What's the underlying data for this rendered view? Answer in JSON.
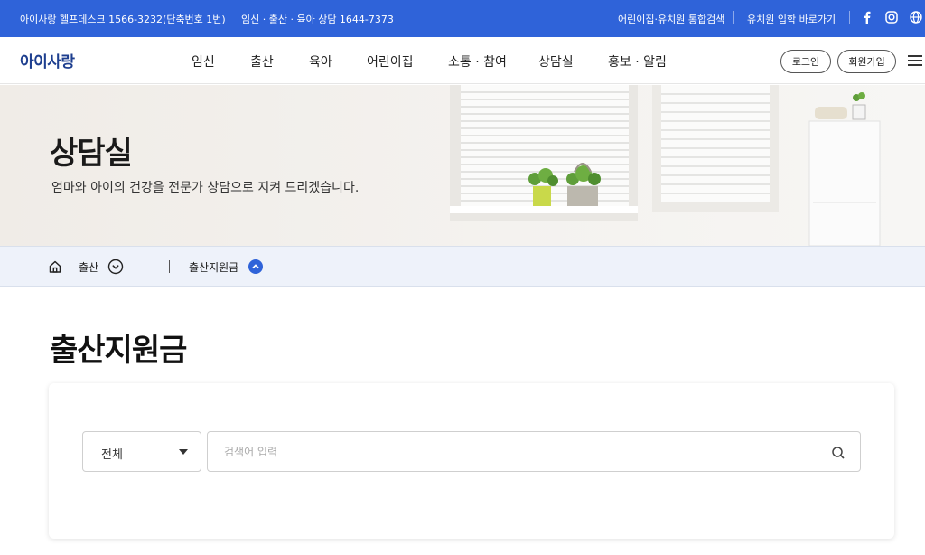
{
  "topbar": {
    "helpdesk": "아이사랑 헬프데스크 1566-3232(단축번호 1번)",
    "counsel": "임신 · 출산 · 육아 상담 1644-7373",
    "integrated_search": "어린이집·유치원 통합검색",
    "kindergarten_link": "유치원 입학 바로가기",
    "icons": [
      "facebook-icon",
      "instagram-icon",
      "globe-icon"
    ]
  },
  "nav": {
    "logo": "아이사랑",
    "menu": [
      "임신",
      "출산",
      "육아",
      "어린이집",
      "소통 · 참여",
      "상담실",
      "홍보 · 알림"
    ],
    "login": "로그인",
    "signup": "회원가입"
  },
  "hero": {
    "title": "상담실",
    "subtitle": "엄마와 아이의 건강을 전문가 상담으로 지켜 드리겠습니다."
  },
  "breadcrumb": {
    "level1": "출산",
    "level2": "출산지원금"
  },
  "page": {
    "title": "출산지원금"
  },
  "search": {
    "category_selected": "전체",
    "placeholder": "검색어 입력",
    "value": ""
  },
  "colors": {
    "topbar": "#2f63d9",
    "hero_bg": "#f1ede8",
    "breadcrumb_bg": "#eef2fa",
    "accent": "#2f63d9"
  }
}
